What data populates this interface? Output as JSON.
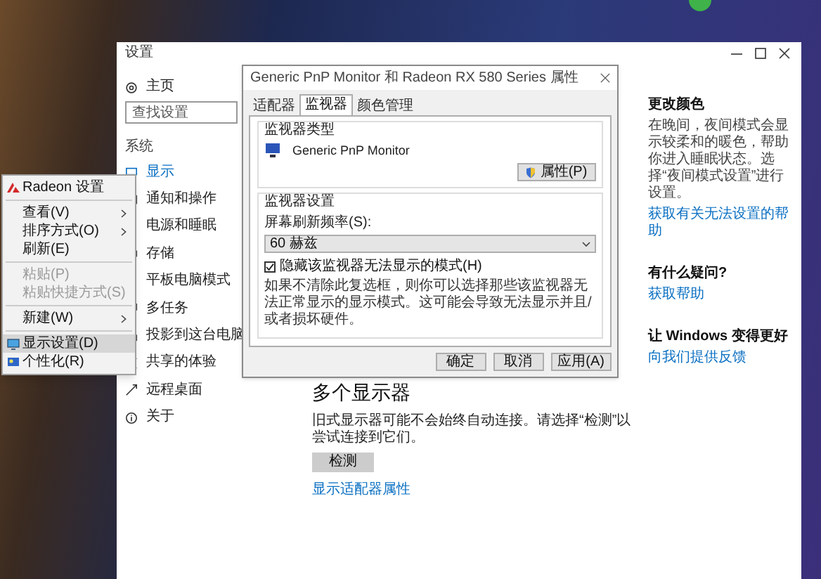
{
  "settings_window": {
    "title": "设置",
    "nav": {
      "home": "主页",
      "search": {
        "placeholder": "查找设置"
      },
      "section": "系统",
      "items": [
        {
          "label": "显示",
          "selected": true
        },
        {
          "label": "通知和操作",
          "selected": false
        },
        {
          "label": "电源和睡眠",
          "selected": false
        },
        {
          "label": "存储",
          "selected": false
        },
        {
          "label": "平板电脑模式",
          "selected": false
        },
        {
          "label": "多任务",
          "selected": false
        },
        {
          "label": "投影到这台电脑",
          "selected": false
        },
        {
          "label": "共享的体验",
          "selected": false
        },
        {
          "label": "远程桌面",
          "selected": false
        },
        {
          "label": "关于",
          "selected": false
        }
      ]
    },
    "main": {
      "heading": "多个显示器",
      "text": "旧式显示器可能不会始终自动连接。请选择“检测”以尝试连接到它们。",
      "button": "检测",
      "link": "显示适配器属性"
    },
    "side": [
      {
        "heading": "更改颜色",
        "text": "在晚间，夜间模式会显示较柔和的暖色，帮助你进入睡眠状态。选择“夜间模式设置”进行设置。",
        "link": "获取有关无法设置的帮助"
      },
      {
        "heading": "有什么疑问?",
        "link": "获取帮助"
      },
      {
        "heading": "让 Windows 变得更好",
        "link": "向我们提供反馈"
      }
    ]
  },
  "dialog": {
    "title": "Generic PnP Monitor 和 Radeon RX 580 Series 属性",
    "tabs": [
      {
        "label": "适配器",
        "selected": false
      },
      {
        "label": "监视器",
        "selected": true
      },
      {
        "label": "颜色管理",
        "selected": false
      }
    ],
    "monitor_type": {
      "legend": "监视器类型",
      "name": "Generic PnP Monitor",
      "button": "属性(P)"
    },
    "monitor_settings": {
      "legend": "监视器设置",
      "refresh_label": "屏幕刷新频率(S):",
      "refresh_value": "60 赫兹",
      "checkbox": {
        "label": "隐藏该监视器无法显示的模式(H)",
        "checked": true
      },
      "note": "如果不清除此复选框，则你可以选择那些该监视器无法正常显示的显示模式。这可能会导致无法显示并且/或者损坏硬件。"
    },
    "buttons": [
      "确定",
      "取消",
      "应用(A)"
    ]
  },
  "context_menu": [
    {
      "kind": "item",
      "label": "Radeon 设置",
      "submenu": false,
      "disabled": false,
      "selected": false
    },
    {
      "kind": "separator"
    },
    {
      "kind": "item",
      "label": "查看(V)",
      "submenu": true,
      "disabled": false,
      "selected": false
    },
    {
      "kind": "item",
      "label": "排序方式(O)",
      "submenu": true,
      "disabled": false,
      "selected": false
    },
    {
      "kind": "item",
      "label": "刷新(E)",
      "submenu": false,
      "disabled": false,
      "selected": false
    },
    {
      "kind": "separator"
    },
    {
      "kind": "item",
      "label": "粘贴(P)",
      "submenu": false,
      "disabled": true,
      "selected": false
    },
    {
      "kind": "item",
      "label": "粘贴快捷方式(S)",
      "submenu": false,
      "disabled": true,
      "selected": false
    },
    {
      "kind": "separator"
    },
    {
      "kind": "item",
      "label": "新建(W)",
      "submenu": true,
      "disabled": false,
      "selected": false
    },
    {
      "kind": "separator"
    },
    {
      "kind": "item",
      "label": "显示设置(D)",
      "submenu": false,
      "disabled": false,
      "selected": true
    },
    {
      "kind": "item",
      "label": "个性化(R)",
      "submenu": false,
      "disabled": false,
      "selected": false
    }
  ]
}
